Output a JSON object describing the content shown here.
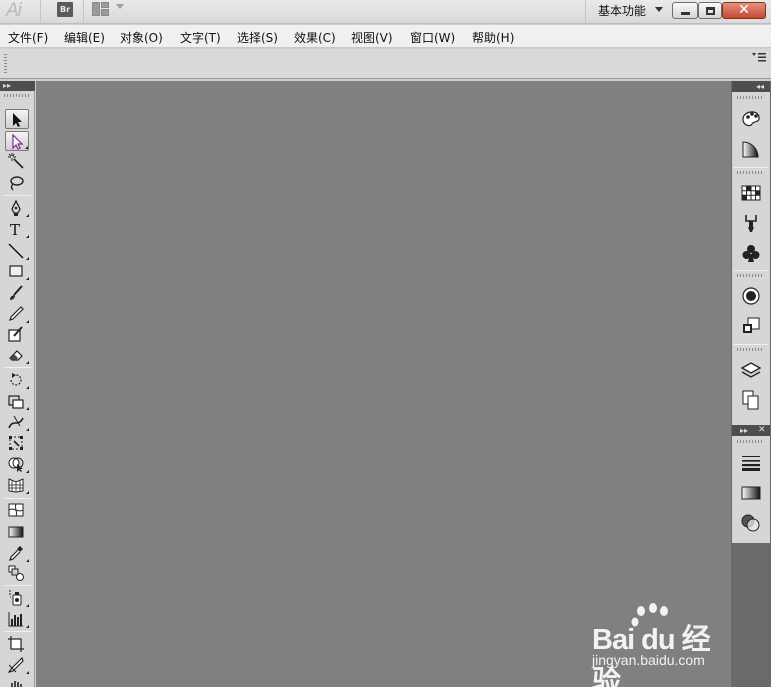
{
  "titlebar": {
    "app_logo": "Ai",
    "bridge_label": "Br",
    "workspace_label": "基本功能",
    "close_glyph": "✕"
  },
  "menubar": {
    "items": [
      {
        "label": "文件(F)"
      },
      {
        "label": "编辑(E)"
      },
      {
        "label": "对象(O)"
      },
      {
        "label": "文字(T)"
      },
      {
        "label": "选择(S)"
      },
      {
        "label": "效果(C)"
      },
      {
        "label": "视图(V)"
      },
      {
        "label": "窗口(W)"
      },
      {
        "label": "帮助(H)"
      }
    ]
  },
  "toolbar": {
    "collapse_glyph": "▸▸",
    "tools": [
      {
        "name": "selection-tool-icon",
        "selected": true
      },
      {
        "name": "direct-selection-tool-icon",
        "selected": true
      },
      {
        "name": "magic-wand-tool-icon"
      },
      {
        "name": "lasso-tool-icon"
      },
      {
        "name": "pen-tool-icon"
      },
      {
        "name": "type-tool-icon",
        "glyph": "T"
      },
      {
        "name": "line-segment-tool-icon"
      },
      {
        "name": "rectangle-tool-icon"
      },
      {
        "name": "paintbrush-tool-icon"
      },
      {
        "name": "pencil-tool-icon"
      },
      {
        "name": "blob-brush-tool-icon"
      },
      {
        "name": "eraser-tool-icon"
      },
      {
        "name": "rotate-tool-icon"
      },
      {
        "name": "scale-tool-icon"
      },
      {
        "name": "width-tool-icon"
      },
      {
        "name": "free-transform-tool-icon"
      },
      {
        "name": "shape-builder-tool-icon"
      },
      {
        "name": "perspective-grid-tool-icon"
      },
      {
        "name": "mesh-tool-icon"
      },
      {
        "name": "gradient-tool-icon"
      },
      {
        "name": "eyedropper-tool-icon"
      },
      {
        "name": "blend-tool-icon"
      },
      {
        "name": "symbol-sprayer-tool-icon"
      },
      {
        "name": "column-graph-tool-icon"
      },
      {
        "name": "artboard-tool-icon"
      },
      {
        "name": "slice-tool-icon"
      },
      {
        "name": "hand-tool-icon"
      }
    ]
  },
  "dock": {
    "collapse_glyph": "◂◂",
    "group2_expand_glyph": "▸▸",
    "group2_close_glyph": "✕",
    "panels": [
      {
        "name": "color-panel-icon"
      },
      {
        "name": "color-guide-panel-icon"
      },
      {
        "name": "swatches-panel-icon"
      },
      {
        "name": "brushes-panel-icon"
      },
      {
        "name": "symbols-panel-icon"
      },
      {
        "name": "appearance-panel-icon"
      },
      {
        "name": "graphic-styles-panel-icon"
      },
      {
        "name": "layers-panel-icon"
      },
      {
        "name": "artboards-panel-icon"
      },
      {
        "name": "stroke-panel-icon"
      },
      {
        "name": "gradient-panel-icon"
      },
      {
        "name": "transparency-panel-icon"
      }
    ]
  },
  "watermark": {
    "logo_text": "Bai du 经验",
    "url": "jingyan.baidu.com"
  },
  "colors": {
    "canvas": "#808080",
    "close_button": "#c24a30",
    "panel_header": "#4e4e4e"
  }
}
